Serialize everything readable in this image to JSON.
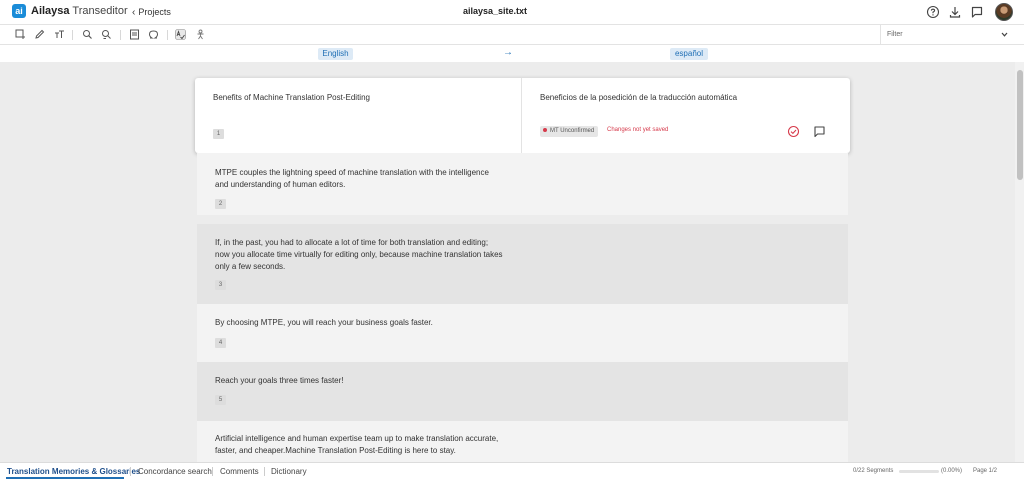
{
  "header": {
    "logo_text": "ai",
    "brand_name": "Ailaysa",
    "product_name": "Transeditor",
    "back_label": "Projects",
    "file_title": "ailaysa_site.txt",
    "icons": [
      "help-circle-icon",
      "download-icon",
      "comment-icon",
      "avatar"
    ]
  },
  "toolbar": {
    "icons": [
      "add-segment-icon",
      "edit-icon",
      "text-size-icon",
      "search-icon",
      "search-replace-icon",
      "preview-icon",
      "omega-special-chars-icon",
      "spellcheck-icon",
      "person-icon"
    ],
    "filter_placeholder": "Filter"
  },
  "languages": {
    "source": "English",
    "arrow": "→",
    "target": "español"
  },
  "active_segment": {
    "number": "1",
    "source": "Benefits of Machine Translation Post-Editing",
    "target": "Beneficios de la posedición de la traducción automática",
    "status": "MT Unconfirmed",
    "status_color": "#d63a4b",
    "note": "Changes not yet saved"
  },
  "segments": [
    {
      "number": "2",
      "lines": [
        "MTPE couples the lightning speed of machine translation with the intelligence",
        "and understanding of human editors."
      ]
    },
    {
      "number": "3",
      "lines": [
        "If, in the past, you had to allocate a lot of time for both translation and editing;",
        "now you allocate time virtually for editing only, because machine translation takes",
        "only a few seconds."
      ]
    },
    {
      "number": "4",
      "lines": [
        "By choosing MTPE, you will reach your business goals faster."
      ]
    },
    {
      "number": "5",
      "lines": [
        "Reach your goals three times faster!"
      ]
    },
    {
      "number": "6",
      "lines": [
        "Artificial intelligence and human expertise team up to make translation accurate,",
        "faster, and cheaper.Machine Translation Post-Editing is here to stay."
      ]
    }
  ],
  "bottom_tabs": [
    {
      "label": "Translation Memories & Glossaries",
      "active": true
    },
    {
      "label": "Concordance search",
      "active": false
    },
    {
      "label": "Comments",
      "active": false
    },
    {
      "label": "Dictionary",
      "active": false
    }
  ],
  "status": {
    "segments": "0/22 Segments",
    "progress_fraction": 0,
    "percent": "(0.00%)",
    "page": "Page 1/2"
  },
  "colors": {
    "accent": "#1f6fb5",
    "logo": "#1a8cd8",
    "alert": "#d63a4b"
  }
}
